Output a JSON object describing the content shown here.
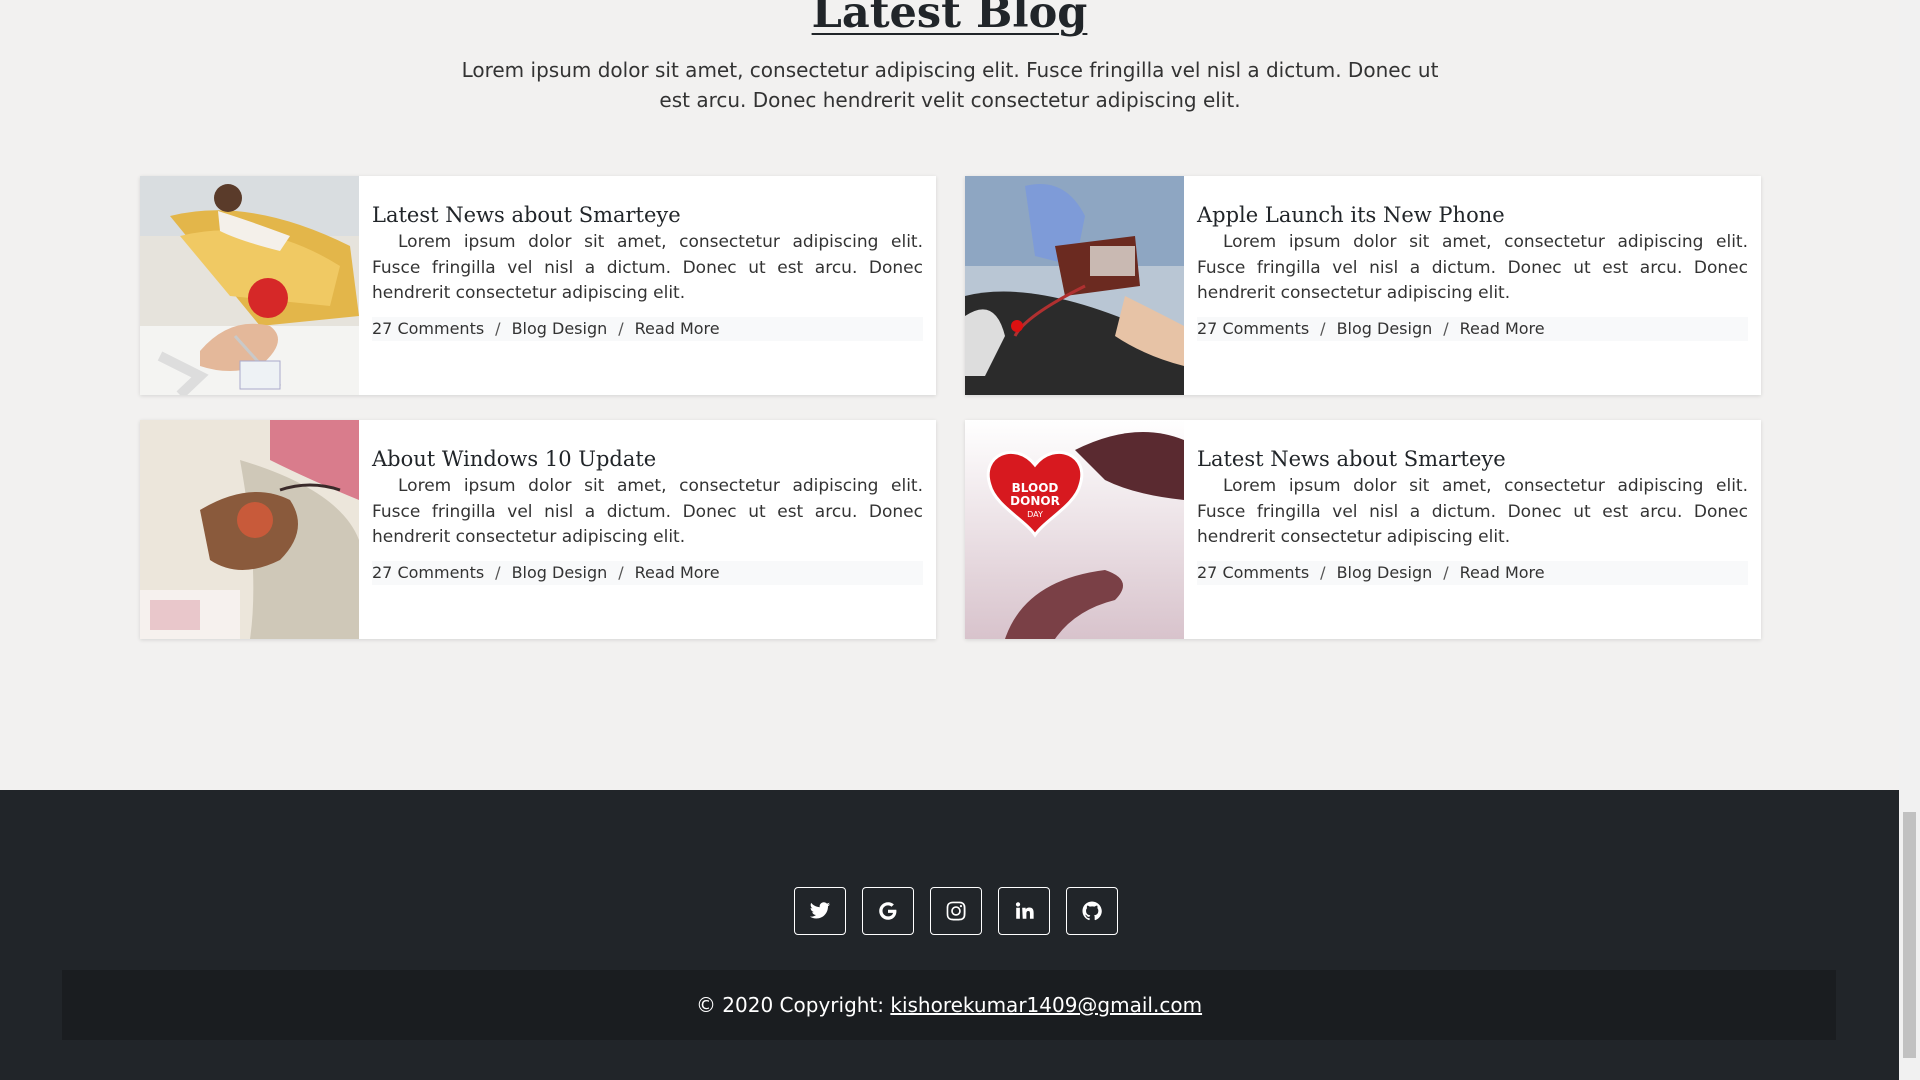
{
  "blog": {
    "title": "Latest Blog",
    "intro": "Lorem ipsum dolor sit amet, consectetur adipiscing elit. Fusce fringilla vel nisl a dictum. Donec ut est arcu. Donec hendrerit velit consectetur adipiscing elit.",
    "posts": [
      {
        "title": "Latest News about Smarteye",
        "text": "Lorem ipsum dolor sit amet, consectetur adipiscing elit. Fusce fringilla vel nisl a dictum. Donec ut est arcu. Donec hendrerit consectetur adipiscing elit.",
        "comments": "27 Comments",
        "category": "Blog Design",
        "read_more": "Read More",
        "image": "blood-donation-chair-photo"
      },
      {
        "title": "Apple Launch its New Phone",
        "text": "Lorem ipsum dolor sit amet, consectetur adipiscing elit. Fusce fringilla vel nisl a dictum. Donec ut est arcu. Donec hendrerit consectetur adipiscing elit.",
        "comments": "27 Comments",
        "category": "Blog Design",
        "read_more": "Read More",
        "image": "blood-bag-gloved-hand-photo"
      },
      {
        "title": "About Windows 10 Update",
        "text": "Lorem ipsum dolor sit amet, consectetur adipiscing elit. Fusce fringilla vel nisl a dictum. Donec ut est arcu. Donec hendrerit consectetur adipiscing elit.",
        "comments": "27 Comments",
        "category": "Blog Design",
        "read_more": "Read More",
        "image": "hand-squeeze-ball-photo"
      },
      {
        "title": "Latest News about Smarteye",
        "text": "Lorem ipsum dolor sit amet, consectetur adipiscing elit. Fusce fringilla vel nisl a dictum. Donec ut est arcu. Donec hendrerit consectetur adipiscing elit.",
        "comments": "27 Comments",
        "category": "Blog Design",
        "read_more": "Read More",
        "image": "blood-donor-day-heart-photo",
        "image_text": [
          "BLOOD",
          "DONOR",
          "DAY"
        ]
      }
    ],
    "separator": "/"
  },
  "footer": {
    "social": [
      "twitter-icon",
      "google-icon",
      "instagram-icon",
      "linkedin-icon",
      "github-icon"
    ],
    "copyright_prefix": "© 2020 Copyright: ",
    "copyright_email": "kishorekumar1409@gmail.com"
  },
  "colors": {
    "page_bg": "#f2f1f0",
    "footer_bg": "#212529",
    "copyright_bg": "#1a1d20"
  }
}
